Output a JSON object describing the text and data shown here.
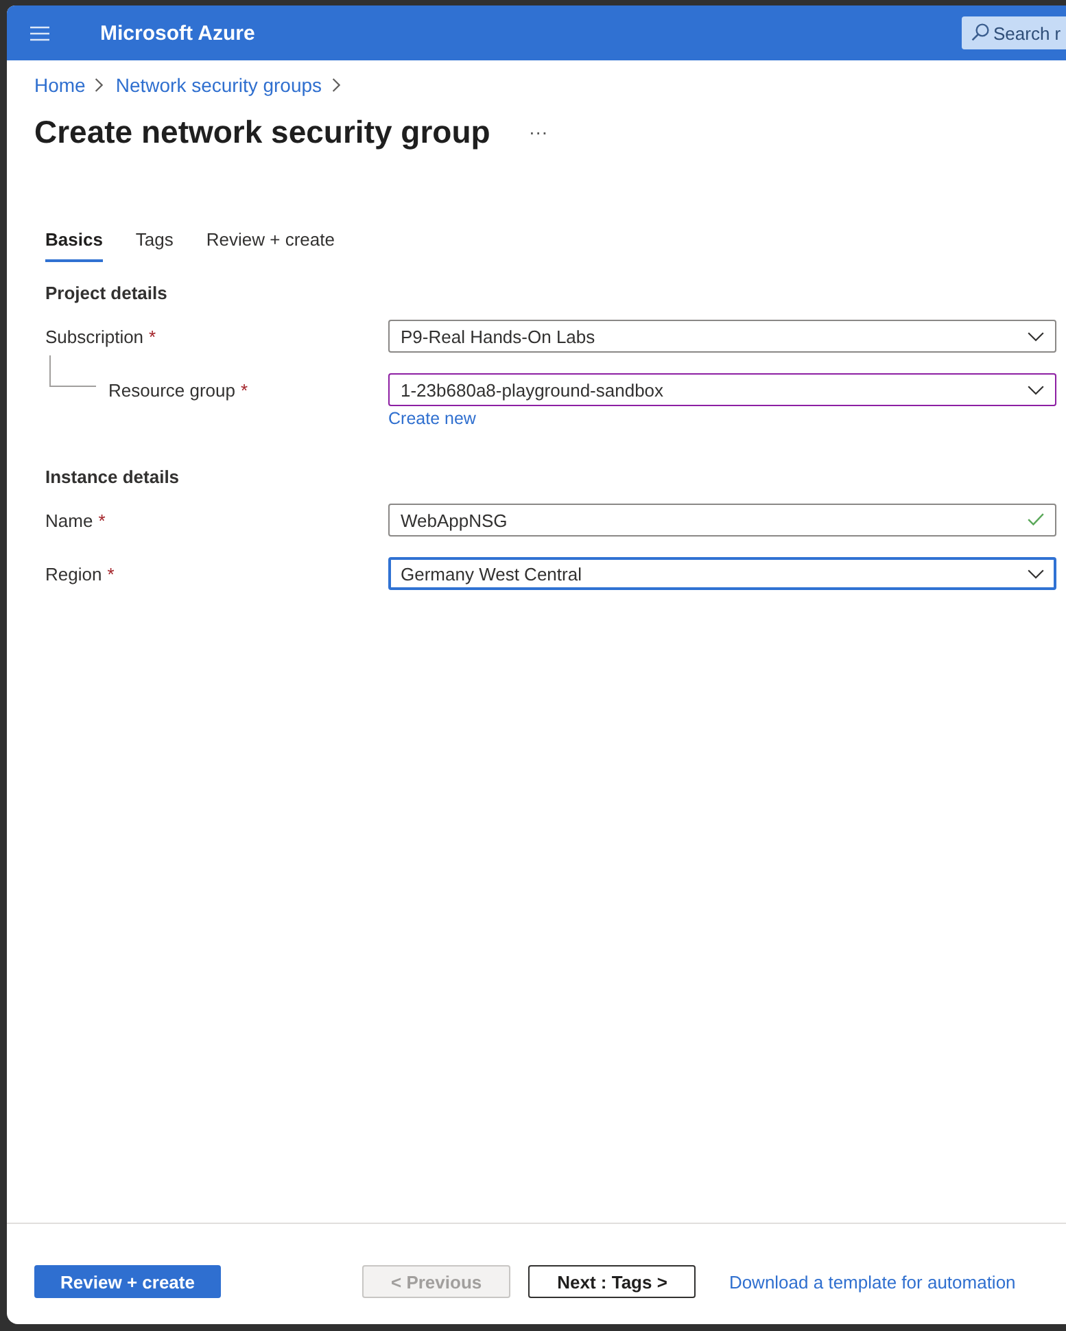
{
  "header": {
    "title": "Microsoft Azure",
    "search": {
      "placeholder": "Search r"
    }
  },
  "breadcrumb": [
    {
      "label": "Home"
    },
    {
      "label": "Network security groups"
    }
  ],
  "page": {
    "title": "Create network security group",
    "more_button": "···"
  },
  "tabs": [
    {
      "label": "Basics",
      "selected": true
    },
    {
      "label": "Tags",
      "selected": false
    },
    {
      "label": "Review + create",
      "selected": false
    }
  ],
  "sections": [
    {
      "title": "Project details",
      "fields": [
        {
          "kind": "dropdown",
          "label": "Subscription",
          "required_mark": "*",
          "value": "P9-Real Hands-On Labs",
          "nested": false,
          "modified": false,
          "focused": false,
          "valid": false
        },
        {
          "kind": "dropdown",
          "label": "Resource group",
          "required_mark": "*",
          "value": "1-23b680a8-playground-sandbox",
          "nested": true,
          "modified": true,
          "focused": false,
          "valid": false,
          "link": "Create new"
        }
      ]
    },
    {
      "title": "Instance details",
      "fields": [
        {
          "kind": "text",
          "label": "Name",
          "required_mark": "*",
          "value": "WebAppNSG",
          "nested": false,
          "modified": false,
          "focused": false,
          "valid": true
        },
        {
          "kind": "dropdown",
          "label": "Region",
          "required_mark": "*",
          "value": "Germany West Central",
          "nested": false,
          "modified": false,
          "focused": true,
          "valid": false
        }
      ]
    }
  ],
  "footer_buttons": [
    {
      "kind": "primary",
      "label": "Review + create",
      "disabled": false
    },
    {
      "kind": "secondary",
      "label": "< Previous",
      "disabled": true
    },
    {
      "kind": "secondary",
      "label": "Next : Tags >",
      "disabled": false
    },
    {
      "kind": "link",
      "label": "Download a template for automation",
      "disabled": false
    }
  ]
}
